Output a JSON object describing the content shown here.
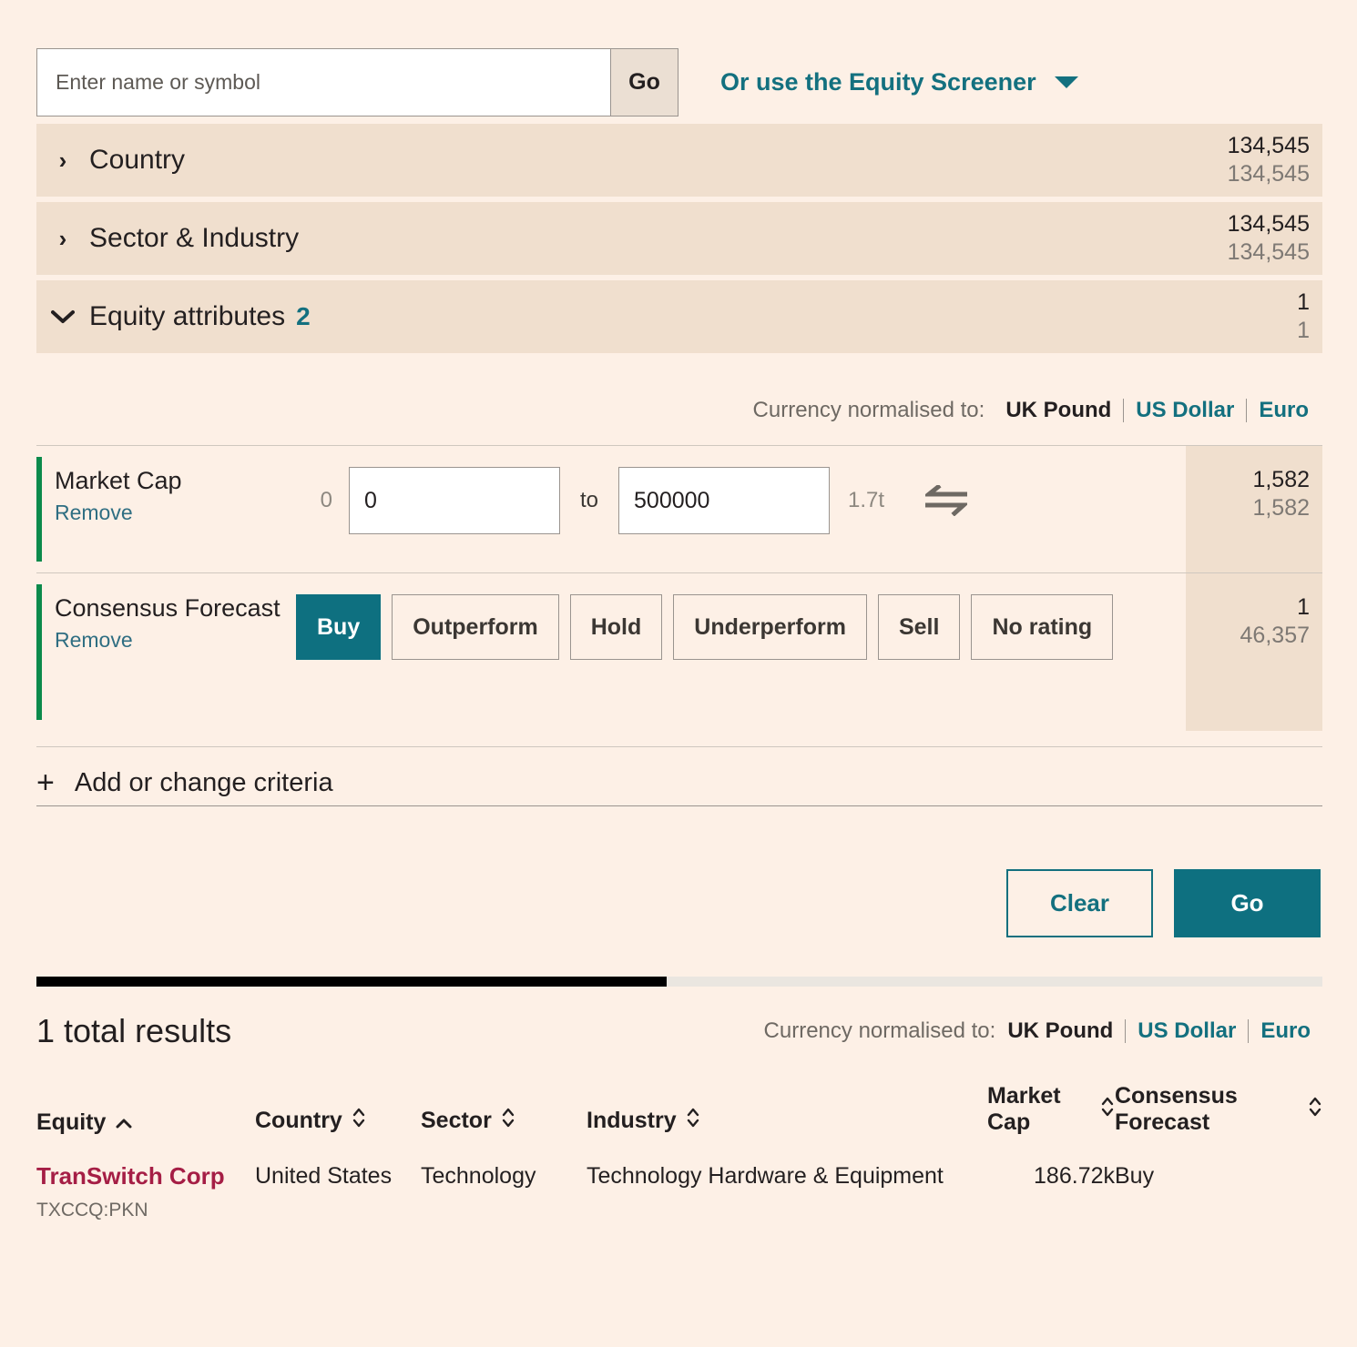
{
  "search": {
    "placeholder": "Enter name or symbol",
    "value": "",
    "go_label": "Go"
  },
  "screener_link": {
    "label": "Or use the Equity Screener",
    "icon": "chevron-down-icon"
  },
  "accordion": [
    {
      "label": "Country",
      "caret": "›",
      "count_top": "134,545",
      "count_bottom": "134,545",
      "badge": ""
    },
    {
      "label": "Sector & Industry",
      "caret": "›",
      "count_top": "134,545",
      "count_bottom": "134,545",
      "badge": ""
    },
    {
      "label": "Equity attributes",
      "caret": "⌄",
      "count_top": "1",
      "count_bottom": "1",
      "badge": "2"
    }
  ],
  "currency": {
    "lead": "Currency normalised to:",
    "options": [
      "UK Pound",
      "US Dollar",
      "Euro"
    ],
    "active": "UK Pound"
  },
  "criteria": {
    "market_cap": {
      "name": "Market Cap",
      "remove_label": "Remove",
      "min_hint": "0",
      "min_value": "0",
      "to_word": "to",
      "max_value": "500000",
      "max_hint": "1.7t",
      "swap_icon": "swap-arrows-icon",
      "count_top": "1,582",
      "count_bottom": "1,582"
    },
    "consensus_forecast": {
      "name": "Consensus Forecast",
      "remove_label": "Remove",
      "options": [
        "Buy",
        "Outperform",
        "Hold",
        "Underperform",
        "Sell",
        "No rating"
      ],
      "selected": "Buy",
      "count_top": "1",
      "count_bottom": "46,357"
    }
  },
  "add_criteria": {
    "label": "Add or change criteria",
    "icon": "plus-icon"
  },
  "actions": {
    "clear_label": "Clear",
    "go_label": "Go"
  },
  "progress": {
    "percent": 49
  },
  "results": {
    "title": "1 total results",
    "columns": [
      {
        "label": "Equity",
        "sort": "asc"
      },
      {
        "label": "Country",
        "sort": "none"
      },
      {
        "label": "Sector",
        "sort": "none"
      },
      {
        "label": "Industry",
        "sort": "none"
      },
      {
        "label": "Market Cap",
        "sort": "none"
      },
      {
        "label": "Consensus Forecast",
        "sort": "none"
      }
    ],
    "rows": [
      {
        "equity": "TranSwitch Corp",
        "ticker": "TXCCQ:PKN",
        "country": "United States",
        "sector": "Technology",
        "industry": "Technology Hardware & Equipment",
        "market_cap": "186.72k",
        "consensus_forecast": "Buy"
      }
    ]
  },
  "colors": {
    "background": "#FDF0E6",
    "panel": "#F0DFCE",
    "teal": "#13707F",
    "teal_solid": "#0E7080",
    "green_accent": "#0B8A4B",
    "equity_link": "#A51E45"
  }
}
